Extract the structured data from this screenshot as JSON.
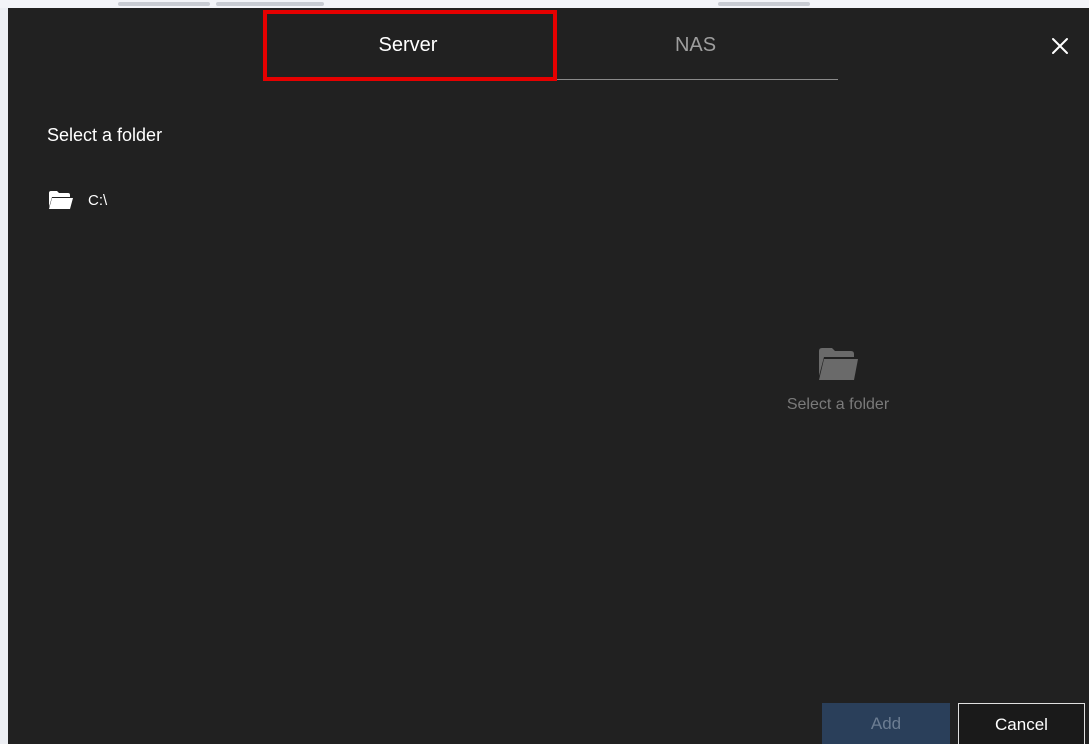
{
  "tabs": [
    {
      "label": "Server",
      "active": true
    },
    {
      "label": "NAS",
      "active": false
    }
  ],
  "close_icon": "close-icon",
  "folder_panel": {
    "title": "Select a folder",
    "items": [
      {
        "label": "C:\\",
        "icon": "folder-open-icon"
      }
    ]
  },
  "empty_state": {
    "icon": "folder-open-icon",
    "text": "Select a folder"
  },
  "buttons": {
    "add_label": "Add",
    "add_enabled": false,
    "cancel_label": "Cancel"
  },
  "colors": {
    "dialog_bg": "#212121",
    "highlight": "#e60000",
    "add_disabled_bg": "#2a3f5a"
  }
}
